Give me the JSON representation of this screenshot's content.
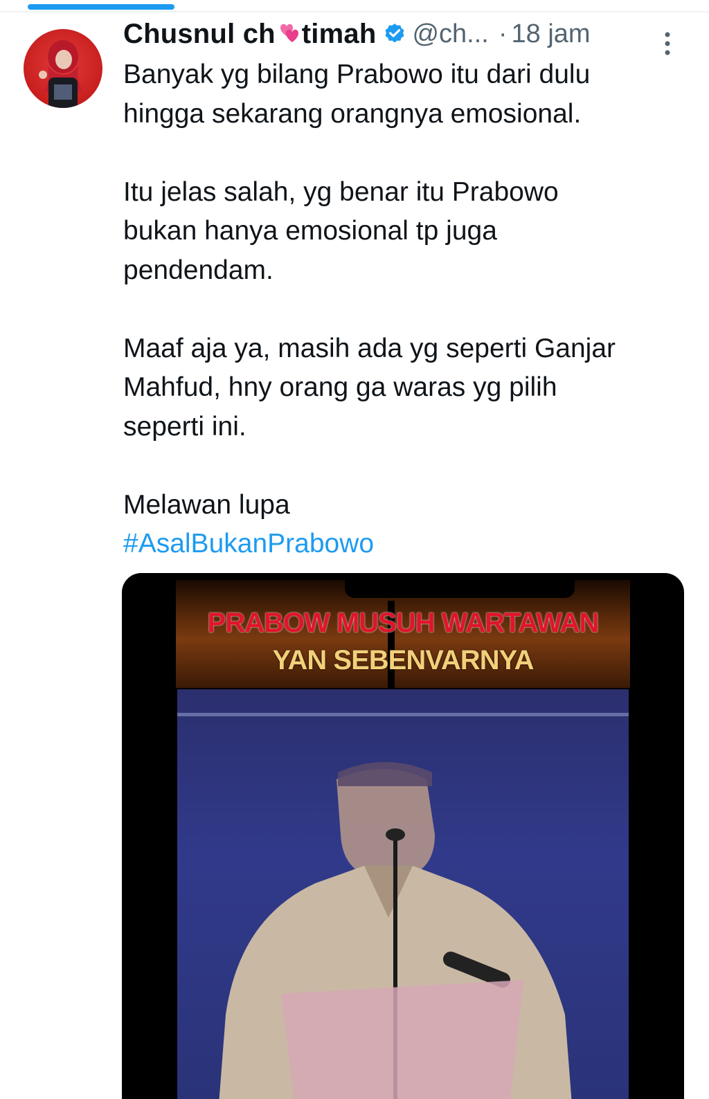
{
  "tweet": {
    "author": {
      "name_part1": "Chusnul ch",
      "name_part2": "timah",
      "handle": "@ch...",
      "separator": "·",
      "time": "18 jam",
      "name_emoji": "two-hearts-icon",
      "verified": "verified-badge-icon"
    },
    "text": {
      "line1": "Banyak yg bilang Prabowo itu dari dulu",
      "line2": "hingga sekarang orangnya emosional.",
      "line3": "Itu jelas salah, yg benar itu Prabowo",
      "line4": "bukan hanya emosional tp juga",
      "line5": "pendendam.",
      "line6": "Maaf aja ya, masih ada yg seperti Ganjar",
      "line7": "Mahfud, hny orang ga waras yg pilih",
      "line8": "seperti ini.",
      "line9": "Melawan lupa",
      "hashtag": "#AsalBukanPrabowo"
    },
    "media": {
      "type": "video",
      "banner_line1": "PRABOW  MUSUH WARTAWAN",
      "banner_line2": "YAN  SEBENVARNYA"
    }
  },
  "colors": {
    "accent": "#1d9bf0",
    "text": "#0f1419",
    "secondary": "#536471"
  }
}
